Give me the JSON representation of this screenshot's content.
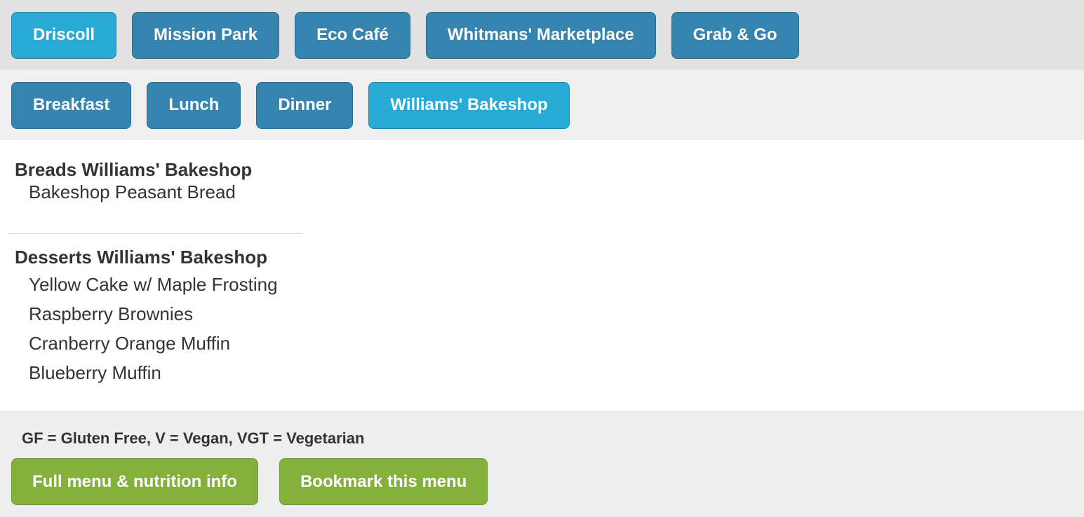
{
  "locations": [
    {
      "label": "Driscoll",
      "active": true
    },
    {
      "label": "Mission Park",
      "active": false
    },
    {
      "label": "Eco Café",
      "active": false
    },
    {
      "label": "Whitmans' Marketplace",
      "active": false
    },
    {
      "label": "Grab & Go",
      "active": false
    }
  ],
  "meals": [
    {
      "label": "Breakfast",
      "active": false
    },
    {
      "label": "Lunch",
      "active": false
    },
    {
      "label": "Dinner",
      "active": false
    },
    {
      "label": "Williams' Bakeshop",
      "active": true
    }
  ],
  "menu": {
    "sections": [
      {
        "title": "Breads Williams' Bakeshop",
        "items": [
          "Bakeshop Peasant Bread"
        ]
      },
      {
        "title": "Desserts Williams' Bakeshop",
        "items": [
          "Yellow Cake w/ Maple Frosting",
          "Raspberry Brownies",
          "Cranberry Orange Muffin",
          "Blueberry Muffin"
        ]
      }
    ]
  },
  "footer": {
    "legend": "GF = Gluten Free, V = Vegan, VGT = Vegetarian",
    "full_menu_label": "Full menu & nutrition info",
    "bookmark_label": "Bookmark this menu"
  },
  "colors": {
    "nav_button": "#3685b0",
    "nav_button_active": "#27abd6",
    "action_button": "#84b03c"
  }
}
